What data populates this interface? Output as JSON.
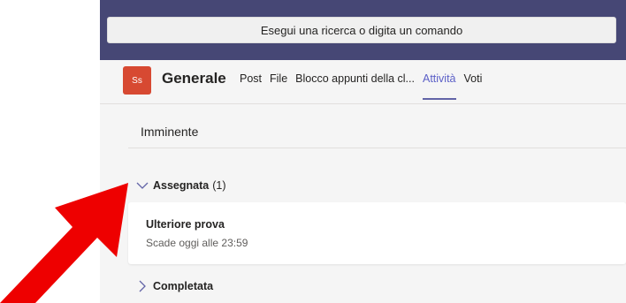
{
  "search": {
    "placeholder": "Esegui una ricerca o digita un comando"
  },
  "channel": {
    "avatar_initials": "Ss",
    "avatar_color": "#d74932",
    "name": "Generale",
    "tabs": [
      {
        "label": "Post",
        "active": false
      },
      {
        "label": "File",
        "active": false
      },
      {
        "label": "Blocco appunti della cl...",
        "active": false
      },
      {
        "label": "Attività",
        "active": true
      },
      {
        "label": "Voti",
        "active": false
      }
    ]
  },
  "main": {
    "section_title": "Imminente",
    "groups": [
      {
        "title": "Assegnata",
        "count": "(1)",
        "expanded": true
      },
      {
        "title": "Completata",
        "expanded": false
      }
    ],
    "assignment": {
      "title": "Ulteriore prova",
      "due": "Scade oggi alle 23:59"
    }
  },
  "colors": {
    "title_bar": "#464775",
    "accent": "#6264a7",
    "annotation_arrow": "#ee0000"
  },
  "icons": {
    "expanded": "chevron-down-icon",
    "collapsed": "chevron-right-icon",
    "annotation": "red-arrow-icon"
  }
}
